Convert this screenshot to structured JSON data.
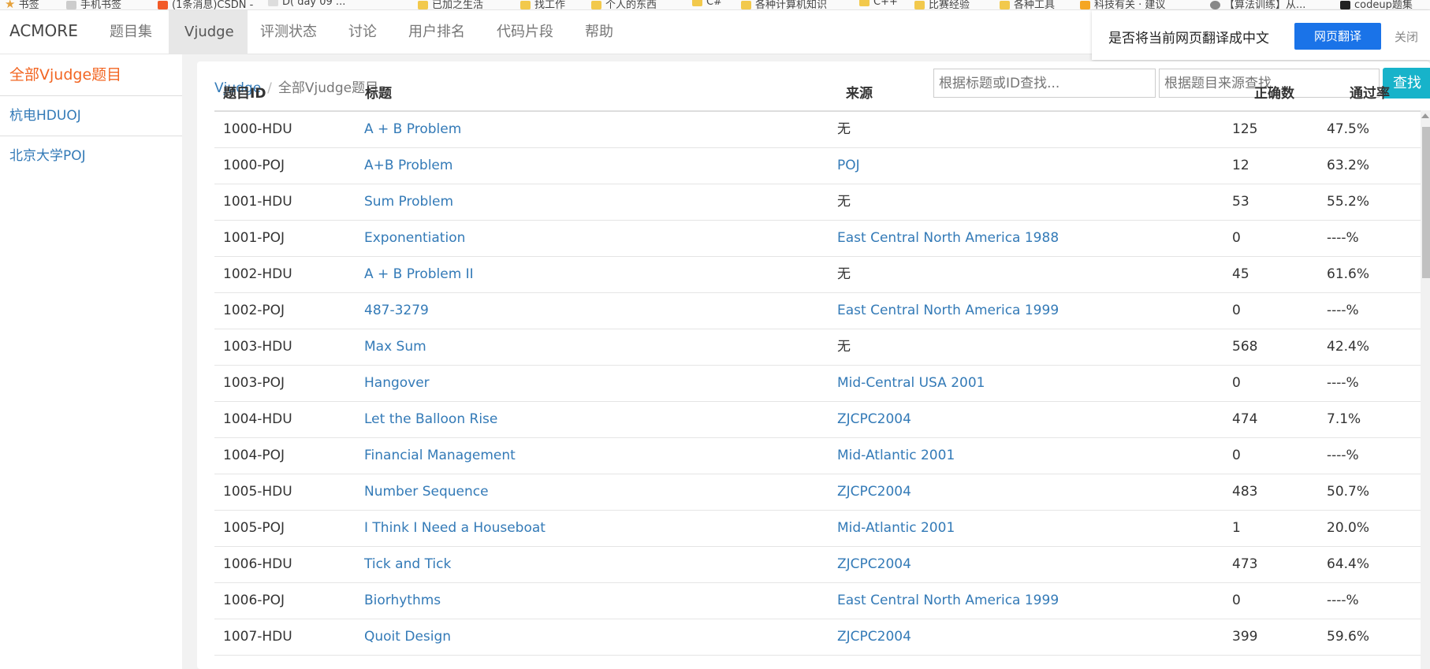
{
  "bookmarks": [
    {
      "label": "书签",
      "icon": "star-icon"
    },
    {
      "label": "手机书签",
      "icon": "phone-icon"
    },
    {
      "label": "(1条消息)CSDN - ",
      "icon": "csdn-icon"
    },
    {
      "label": "D( day 09 ...",
      "icon": "page-icon"
    },
    {
      "label": "已加之生活",
      "icon": "folder-icon"
    },
    {
      "label": "找工作",
      "icon": "folder-icon"
    },
    {
      "label": "个人的东西",
      "icon": "folder-icon"
    },
    {
      "label": "C#",
      "icon": "folder-icon"
    },
    {
      "label": "各种计算机知识",
      "icon": "folder-icon"
    },
    {
      "label": "C++",
      "icon": "folder-icon"
    },
    {
      "label": "比赛经验",
      "icon": "folder-icon"
    },
    {
      "label": "各种工具",
      "icon": "folder-icon"
    },
    {
      "label": "科技有关 · 建议",
      "icon": "folder-icon"
    },
    {
      "label": "【算法训练】从...",
      "icon": "globe-icon"
    },
    {
      "label": "codeup题集",
      "icon": "code-icon"
    }
  ],
  "navbar": {
    "brand": "ACMORE",
    "items": [
      {
        "label": "题目集",
        "active": false
      },
      {
        "label": "Vjudge",
        "active": true
      },
      {
        "label": "评测状态",
        "active": false
      },
      {
        "label": "讨论",
        "active": false
      },
      {
        "label": "用户排名",
        "active": false
      },
      {
        "label": "代码片段",
        "active": false
      },
      {
        "label": "帮助",
        "active": false
      }
    ]
  },
  "translate": {
    "question": "是否将当前网页翻译成中文",
    "button": "网页翻译",
    "close": "关闭"
  },
  "sidebar": {
    "items": [
      {
        "label": "全部Vjudge题目",
        "active": true
      },
      {
        "label": "杭电HDUOJ",
        "active": false
      },
      {
        "label": "北京大学POJ",
        "active": false
      }
    ]
  },
  "breadcrumb": {
    "root": "Vjudge",
    "separator": "/",
    "current": "全部Vjudge题目"
  },
  "search": {
    "title_placeholder": "根据标题或ID查找...",
    "source_placeholder": "根据题目来源查找",
    "button": "查找"
  },
  "table": {
    "headers": {
      "id": "题目ID",
      "title": "标题",
      "source": "来源",
      "accepted": "正确数",
      "rate": "通过率"
    },
    "rows": [
      {
        "id": "1000-HDU",
        "title": "A + B Problem",
        "source": "无",
        "source_link": false,
        "accepted": "125",
        "rate": "47.5%"
      },
      {
        "id": "1000-POJ",
        "title": "A+B Problem",
        "source": "POJ",
        "source_link": true,
        "accepted": "12",
        "rate": "63.2%"
      },
      {
        "id": "1001-HDU",
        "title": "Sum Problem",
        "source": "无",
        "source_link": false,
        "accepted": "53",
        "rate": "55.2%"
      },
      {
        "id": "1001-POJ",
        "title": "Exponentiation",
        "source": "East Central North America 1988",
        "source_link": true,
        "accepted": "0",
        "rate": "----%"
      },
      {
        "id": "1002-HDU",
        "title": "A + B Problem II",
        "source": "无",
        "source_link": false,
        "accepted": "45",
        "rate": "61.6%"
      },
      {
        "id": "1002-POJ",
        "title": "487-3279",
        "source": "East Central North America 1999",
        "source_link": true,
        "accepted": "0",
        "rate": "----%"
      },
      {
        "id": "1003-HDU",
        "title": "Max Sum",
        "source": "无",
        "source_link": false,
        "accepted": "568",
        "rate": "42.4%"
      },
      {
        "id": "1003-POJ",
        "title": "Hangover",
        "source": "Mid-Central USA 2001",
        "source_link": true,
        "accepted": "0",
        "rate": "----%"
      },
      {
        "id": "1004-HDU",
        "title": "Let the Balloon Rise",
        "source": "ZJCPC2004",
        "source_link": true,
        "accepted": "474",
        "rate": "7.1%"
      },
      {
        "id": "1004-POJ",
        "title": "Financial Management",
        "source": "Mid-Atlantic 2001",
        "source_link": true,
        "accepted": "0",
        "rate": "----%"
      },
      {
        "id": "1005-HDU",
        "title": "Number Sequence",
        "source": "ZJCPC2004",
        "source_link": true,
        "accepted": "483",
        "rate": "50.7%"
      },
      {
        "id": "1005-POJ",
        "title": "I Think I Need a Houseboat",
        "source": "Mid-Atlantic 2001",
        "source_link": true,
        "accepted": "1",
        "rate": "20.0%"
      },
      {
        "id": "1006-HDU",
        "title": "Tick and Tick",
        "source": "ZJCPC2004",
        "source_link": true,
        "accepted": "473",
        "rate": "64.4%"
      },
      {
        "id": "1006-POJ",
        "title": "Biorhythms",
        "source": "East Central North America 1999",
        "source_link": true,
        "accepted": "0",
        "rate": "----%"
      },
      {
        "id": "1007-HDU",
        "title": "Quoit Design",
        "source": "ZJCPC2004",
        "source_link": true,
        "accepted": "399",
        "rate": "59.6%"
      }
    ]
  },
  "colors": {
    "link": "#337ab7",
    "active_sidebar": "#f26522",
    "search_button": "#17b3ca",
    "translate_button": "#1a73e8"
  }
}
